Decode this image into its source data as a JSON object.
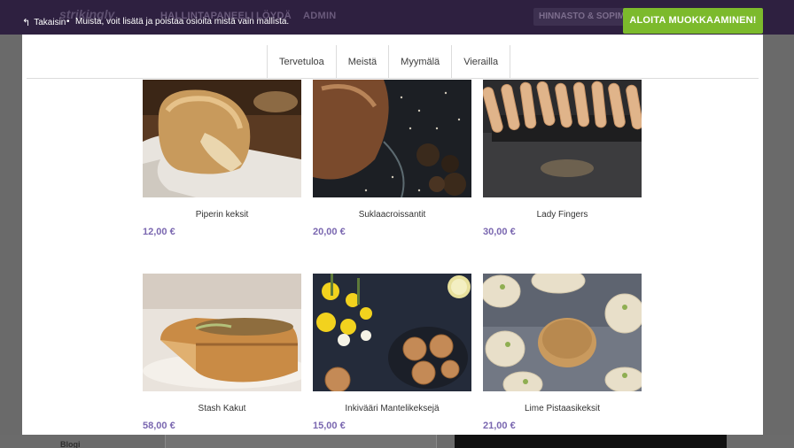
{
  "topbar": {
    "logo_ghost": "strikingly",
    "ghost_nav": [
      "HALLINTAPANEELI",
      "LÖYDÄ",
      "ADMIN"
    ],
    "ghost_button": "HINNASTO & SOPIMUKSET",
    "back_label": "Takaisin",
    "notice": "Muista, voit lisätä ja poistaa osioita mistä vain mallista.",
    "start_button": "ALOITA MUOKKAAMINEN!",
    "colors": {
      "bar": "#2e2040",
      "start_button": "#7cba2c"
    }
  },
  "preview": {
    "nav_tabs": [
      "Tervetuloa",
      "Meistä",
      "Myymälä",
      "Vierailla"
    ],
    "products": [
      {
        "name": "Piperin keksit",
        "price": "12,00 €",
        "image_icon": "bread-loaf-photo"
      },
      {
        "name": "Suklaacroissantit",
        "price": "20,00 €",
        "image_icon": "round-bread-photo"
      },
      {
        "name": "Lady Fingers",
        "price": "30,00 €",
        "image_icon": "lady-fingers-photo"
      },
      {
        "name": "Stash Kakut",
        "price": "58,00 €",
        "image_icon": "quiche-photo"
      },
      {
        "name": "Inkivääri Mantelikeksejä",
        "price": "15,00 €",
        "image_icon": "almond-cookies-photo"
      },
      {
        "name": "Lime Pistaasikeksit",
        "price": "21,00 €",
        "image_icon": "pistachio-cookies-photo"
      }
    ],
    "colors": {
      "price": "#7a67b0"
    }
  },
  "background": {
    "blog_label": "Blogi"
  }
}
